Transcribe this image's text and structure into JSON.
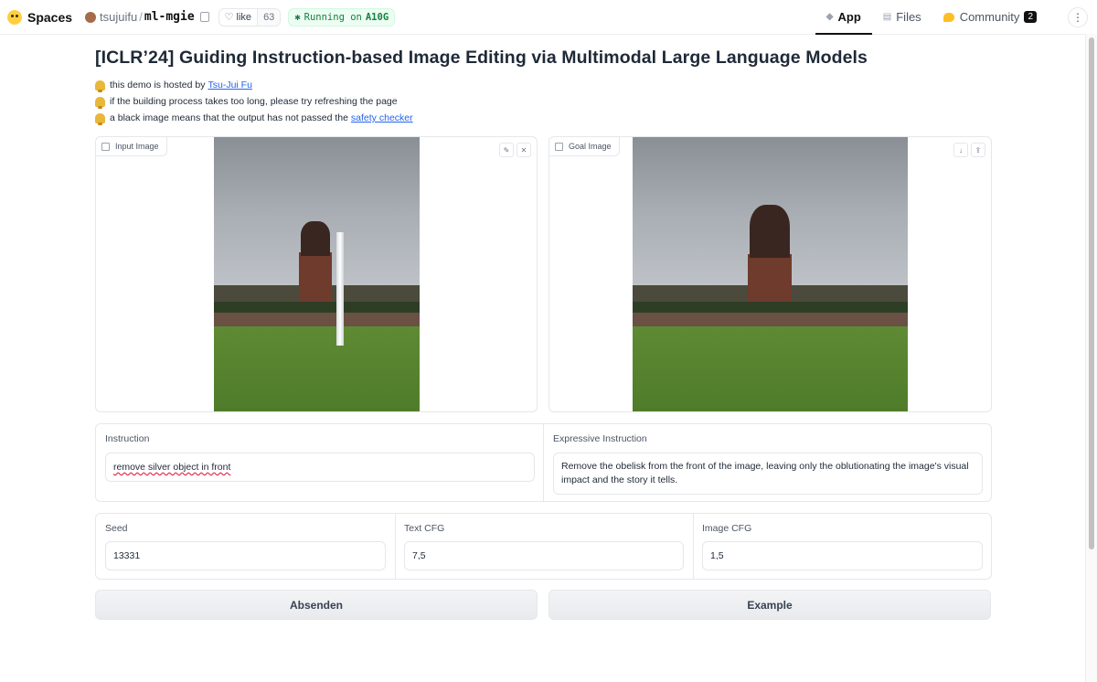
{
  "header": {
    "brand": "Spaces",
    "owner": "tsujuifu",
    "separator": "/",
    "repo": "ml-mgie",
    "like_label": "like",
    "like_count": "63",
    "status_label": "Running on",
    "status_hw": "A10G",
    "nav": [
      {
        "label": "App"
      },
      {
        "label": "Files"
      },
      {
        "label": "Community"
      }
    ],
    "community_badge": "2"
  },
  "page": {
    "title": "[ICLR’24] Guiding Instruction-based Image Editing via Multimodal Large Language Models",
    "notes": [
      {
        "text": "this demo is hosted by",
        "link": "Tsu-Jui Fu"
      },
      {
        "text": "if the building process takes too long, please try refreshing the page",
        "link": ""
      },
      {
        "text": "a black image means that the output has not passed the",
        "link": "safety checker"
      }
    ]
  },
  "images": {
    "input_label": "Input Image",
    "goal_label": "Goal Image"
  },
  "instruction": {
    "label": "Instruction",
    "value": "remove silver object in front"
  },
  "expressive": {
    "label": "Expressive Instruction",
    "value": "Remove the obelisk from the front of the image, leaving only the oblutionating the image's visual impact and the story it tells."
  },
  "params": {
    "seed_label": "Seed",
    "seed_value": "13331",
    "text_cfg_label": "Text CFG",
    "text_cfg_value": "7,5",
    "image_cfg_label": "Image CFG",
    "image_cfg_value": "1,5"
  },
  "buttons": {
    "submit": "Absenden",
    "example": "Example"
  },
  "colors": {
    "accent": "#2563eb",
    "running_green": "#15803d"
  }
}
